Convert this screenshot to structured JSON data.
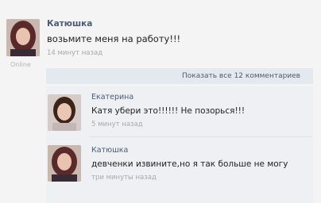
{
  "post": {
    "author": "Катюшка",
    "text": "возьмите меня на работу!!!",
    "time": "14 минут назад",
    "status": "Online"
  },
  "show_all_label": "Показать все 12 комментариев",
  "comments": [
    {
      "author": "Екатерина",
      "text": "Катя убери это!!!!!! Не позорься!!!",
      "time": "5 минут назад"
    },
    {
      "author": "Катюшка",
      "text": "девченки извините,но я так больше не могу",
      "time": "три минуты назад"
    }
  ]
}
